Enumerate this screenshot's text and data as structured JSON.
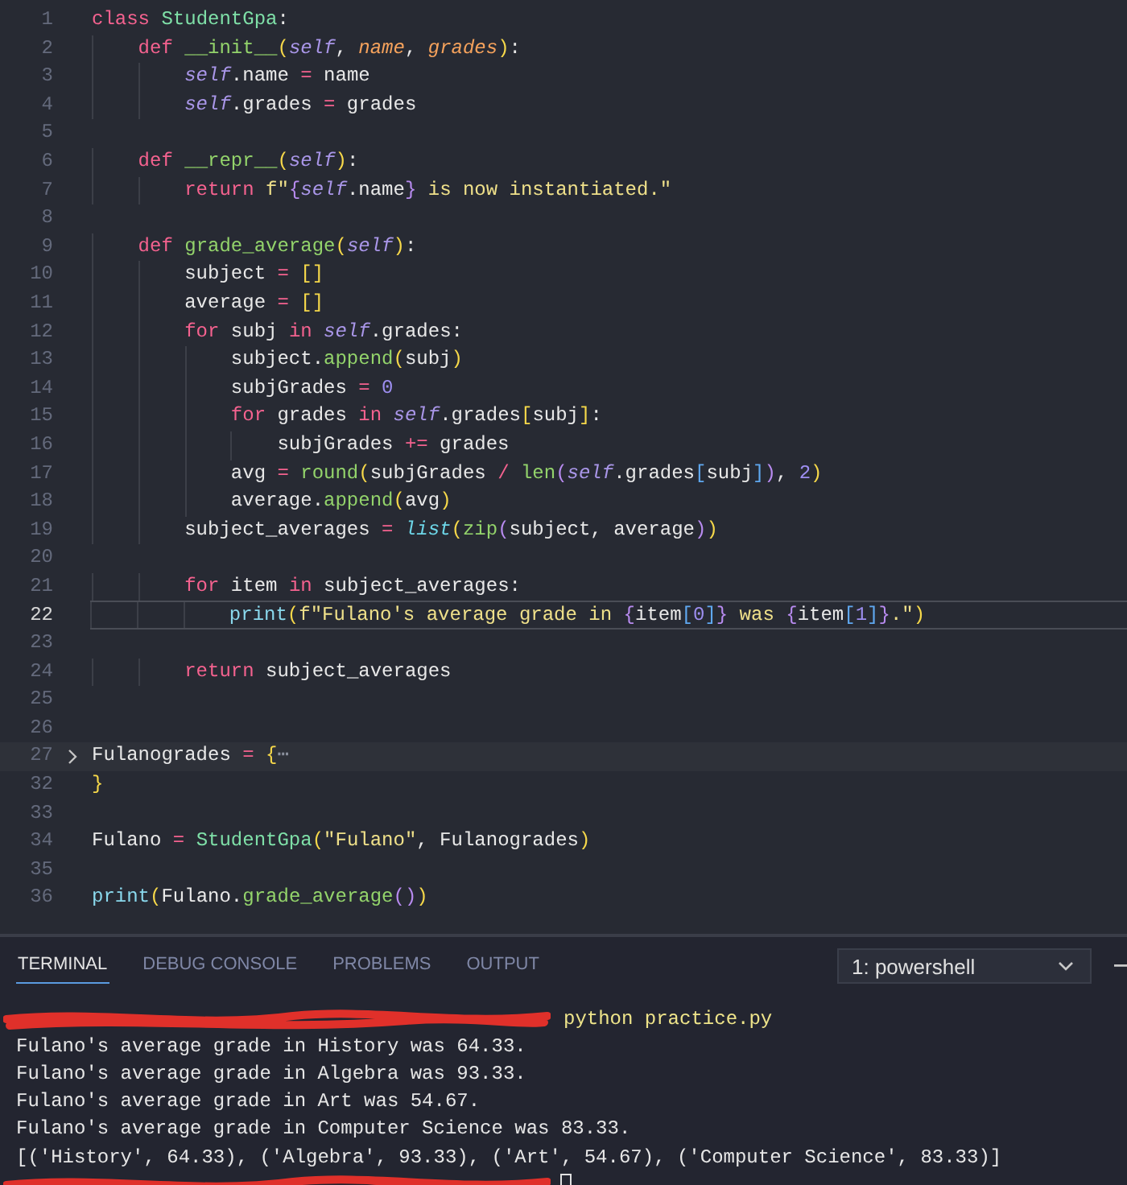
{
  "editor": {
    "lines": [
      {
        "number": "1",
        "tokens": [
          {
            "kind": "kw",
            "text": "class"
          },
          {
            "kind": "cls",
            "text": " StudentGpa"
          },
          {
            "kind": "plain",
            "text": ":"
          }
        ]
      },
      {
        "number": "2",
        "tokens": [
          {
            "kind": "kw",
            "text": "    def"
          },
          {
            "kind": "fn",
            "text": " __init__"
          },
          {
            "kind": "br",
            "text": "("
          },
          {
            "kind": "self",
            "text": "self"
          },
          {
            "kind": "plain",
            "text": ", "
          },
          {
            "kind": "param",
            "text": "name"
          },
          {
            "kind": "plain",
            "text": ", "
          },
          {
            "kind": "param",
            "text": "grades"
          },
          {
            "kind": "br",
            "text": ")"
          },
          {
            "kind": "plain",
            "text": ":"
          }
        ]
      },
      {
        "number": "3",
        "tokens": [
          {
            "kind": "self",
            "text": "        self"
          },
          {
            "kind": "plain",
            "text": ".name "
          },
          {
            "kind": "op",
            "text": "="
          },
          {
            "kind": "plain",
            "text": " name"
          }
        ]
      },
      {
        "number": "4",
        "tokens": [
          {
            "kind": "self",
            "text": "        self"
          },
          {
            "kind": "plain",
            "text": ".grades "
          },
          {
            "kind": "op",
            "text": "="
          },
          {
            "kind": "plain",
            "text": " grades"
          }
        ]
      },
      {
        "number": "5"
      },
      {
        "number": "6",
        "tokens": [
          {
            "kind": "kw",
            "text": "    def"
          },
          {
            "kind": "fn",
            "text": " __repr__"
          },
          {
            "kind": "br",
            "text": "("
          },
          {
            "kind": "self",
            "text": "self"
          },
          {
            "kind": "br",
            "text": ")"
          },
          {
            "kind": "plain",
            "text": ":"
          }
        ]
      },
      {
        "number": "7",
        "tokens": [
          {
            "kind": "kw",
            "text": "        return"
          },
          {
            "kind": "str",
            "text": " f\""
          },
          {
            "kind": "br2",
            "text": "{"
          },
          {
            "kind": "self",
            "text": "self"
          },
          {
            "kind": "plain",
            "text": ".name"
          },
          {
            "kind": "br2",
            "text": "}"
          },
          {
            "kind": "str",
            "text": " is now instantiated.\""
          }
        ]
      },
      {
        "number": "8"
      },
      {
        "number": "9",
        "tokens": [
          {
            "kind": "kw",
            "text": "    def"
          },
          {
            "kind": "fn",
            "text": " grade_average"
          },
          {
            "kind": "br",
            "text": "("
          },
          {
            "kind": "self",
            "text": "self"
          },
          {
            "kind": "br",
            "text": ")"
          },
          {
            "kind": "plain",
            "text": ":"
          }
        ]
      },
      {
        "number": "10",
        "tokens": [
          {
            "kind": "plain",
            "text": "        subject "
          },
          {
            "kind": "op",
            "text": "="
          },
          {
            "kind": "br",
            "text": " []"
          }
        ]
      },
      {
        "number": "11",
        "tokens": [
          {
            "kind": "plain",
            "text": "        average "
          },
          {
            "kind": "op",
            "text": "="
          },
          {
            "kind": "br",
            "text": " []"
          }
        ]
      },
      {
        "number": "12",
        "tokens": [
          {
            "kind": "kw",
            "text": "        for"
          },
          {
            "kind": "plain",
            "text": " subj "
          },
          {
            "kind": "kw",
            "text": "in"
          },
          {
            "kind": "self",
            "text": " self"
          },
          {
            "kind": "plain",
            "text": ".grades:"
          }
        ]
      },
      {
        "number": "13",
        "tokens": [
          {
            "kind": "plain",
            "text": "            subject."
          },
          {
            "kind": "fn",
            "text": "append"
          },
          {
            "kind": "br",
            "text": "("
          },
          {
            "kind": "plain",
            "text": "subj"
          },
          {
            "kind": "br",
            "text": ")"
          }
        ]
      },
      {
        "number": "14",
        "tokens": [
          {
            "kind": "plain",
            "text": "            subjGrades "
          },
          {
            "kind": "op",
            "text": "="
          },
          {
            "kind": "num",
            "text": " 0"
          }
        ]
      },
      {
        "number": "15",
        "tokens": [
          {
            "kind": "kw",
            "text": "            for"
          },
          {
            "kind": "plain",
            "text": " grades "
          },
          {
            "kind": "kw",
            "text": "in"
          },
          {
            "kind": "self",
            "text": " self"
          },
          {
            "kind": "plain",
            "text": ".grades"
          },
          {
            "kind": "br",
            "text": "["
          },
          {
            "kind": "plain",
            "text": "subj"
          },
          {
            "kind": "br",
            "text": "]"
          },
          {
            "kind": "plain",
            "text": ":"
          }
        ]
      },
      {
        "number": "16",
        "tokens": [
          {
            "kind": "plain",
            "text": "                subjGrades "
          },
          {
            "kind": "op",
            "text": "+="
          },
          {
            "kind": "plain",
            "text": " grades"
          }
        ]
      },
      {
        "number": "17",
        "tokens": [
          {
            "kind": "plain",
            "text": "            avg "
          },
          {
            "kind": "op",
            "text": "="
          },
          {
            "kind": "fn",
            "text": " round"
          },
          {
            "kind": "br",
            "text": "("
          },
          {
            "kind": "plain",
            "text": "subjGrades "
          },
          {
            "kind": "op",
            "text": "/"
          },
          {
            "kind": "fn",
            "text": " len"
          },
          {
            "kind": "br2",
            "text": "("
          },
          {
            "kind": "self",
            "text": "self"
          },
          {
            "kind": "plain",
            "text": ".grades"
          },
          {
            "kind": "br3",
            "text": "["
          },
          {
            "kind": "plain",
            "text": "subj"
          },
          {
            "kind": "br3",
            "text": "]"
          },
          {
            "kind": "br2",
            "text": ")"
          },
          {
            "kind": "plain",
            "text": ", "
          },
          {
            "kind": "num",
            "text": "2"
          },
          {
            "kind": "br",
            "text": ")"
          }
        ]
      },
      {
        "number": "18",
        "tokens": [
          {
            "kind": "plain",
            "text": "            average."
          },
          {
            "kind": "fn",
            "text": "append"
          },
          {
            "kind": "br",
            "text": "("
          },
          {
            "kind": "plain",
            "text": "avg"
          },
          {
            "kind": "br",
            "text": ")"
          }
        ]
      },
      {
        "number": "19",
        "tokens": [
          {
            "kind": "plain",
            "text": "        subject_averages "
          },
          {
            "kind": "op",
            "text": "="
          },
          {
            "kind": "builtin",
            "text": " list"
          },
          {
            "kind": "br",
            "text": "("
          },
          {
            "kind": "fn",
            "text": "zip"
          },
          {
            "kind": "br2",
            "text": "("
          },
          {
            "kind": "plain",
            "text": "subject, average"
          },
          {
            "kind": "br2",
            "text": ")"
          },
          {
            "kind": "br",
            "text": ")"
          }
        ]
      },
      {
        "number": "20"
      },
      {
        "number": "21",
        "tokens": [
          {
            "kind": "kw",
            "text": "        for"
          },
          {
            "kind": "plain",
            "text": " item "
          },
          {
            "kind": "kw",
            "text": "in"
          },
          {
            "kind": "plain",
            "text": " subject_averages:"
          }
        ]
      },
      {
        "number": "22",
        "current": true,
        "tokens": [
          {
            "kind": "call",
            "text": "            print"
          },
          {
            "kind": "br",
            "text": "("
          },
          {
            "kind": "str",
            "text": "f\"Fulano's average grade in "
          },
          {
            "kind": "br2",
            "text": "{"
          },
          {
            "kind": "plain",
            "text": "item"
          },
          {
            "kind": "br3",
            "text": "["
          },
          {
            "kind": "num",
            "text": "0"
          },
          {
            "kind": "br3",
            "text": "]"
          },
          {
            "kind": "br2",
            "text": "}"
          },
          {
            "kind": "str",
            "text": " was "
          },
          {
            "kind": "br2",
            "text": "{"
          },
          {
            "kind": "plain",
            "text": "item"
          },
          {
            "kind": "br3",
            "text": "["
          },
          {
            "kind": "num",
            "text": "1"
          },
          {
            "kind": "br3",
            "text": "]"
          },
          {
            "kind": "br2",
            "text": "}"
          },
          {
            "kind": "str",
            "text": ".\""
          },
          {
            "kind": "br",
            "text": ")"
          }
        ]
      },
      {
        "number": "23"
      },
      {
        "number": "24",
        "tokens": [
          {
            "kind": "kw",
            "text": "        return"
          },
          {
            "kind": "plain",
            "text": " subject_averages"
          }
        ]
      },
      {
        "number": "25"
      },
      {
        "number": "26"
      },
      {
        "number": "27",
        "folded": true,
        "tokens": [
          {
            "kind": "plain",
            "text": "Fulanogrades "
          },
          {
            "kind": "op",
            "text": "="
          },
          {
            "kind": "br",
            "text": " {"
          },
          {
            "kind": "fold",
            "text": "⋯"
          }
        ]
      },
      {
        "number": "32",
        "tokens": [
          {
            "kind": "br",
            "text": "}"
          }
        ]
      },
      {
        "number": "33"
      },
      {
        "number": "34",
        "tokens": [
          {
            "kind": "plain",
            "text": "Fulano "
          },
          {
            "kind": "op",
            "text": "="
          },
          {
            "kind": "cls",
            "text": " StudentGpa"
          },
          {
            "kind": "br",
            "text": "("
          },
          {
            "kind": "str",
            "text": "\"Fulano\""
          },
          {
            "kind": "plain",
            "text": ", Fulanogrades"
          },
          {
            "kind": "br",
            "text": ")"
          }
        ]
      },
      {
        "number": "35"
      },
      {
        "number": "36",
        "tokens": [
          {
            "kind": "call",
            "text": "print"
          },
          {
            "kind": "br",
            "text": "("
          },
          {
            "kind": "plain",
            "text": "Fulano."
          },
          {
            "kind": "fn",
            "text": "grade_average"
          },
          {
            "kind": "br2",
            "text": "()"
          },
          {
            "kind": "br",
            "text": ")"
          }
        ]
      }
    ]
  },
  "panel": {
    "tabs": [
      {
        "label": "TERMINAL",
        "selected": true
      },
      {
        "label": "DEBUG CONSOLE",
        "selected": false
      },
      {
        "label": "PROBLEMS",
        "selected": false
      },
      {
        "label": "OUTPUT",
        "selected": false
      }
    ],
    "shell_dropdown": {
      "value": "1: powershell"
    },
    "terminal_lines": [
      {
        "kind": "prompt",
        "command": "python practice.py"
      },
      {
        "kind": "output",
        "text": "Fulano's average grade in History was 64.33."
      },
      {
        "kind": "output",
        "text": "Fulano's average grade in Algebra was 93.33."
      },
      {
        "kind": "output",
        "text": "Fulano's average grade in Art was 54.67."
      },
      {
        "kind": "output",
        "text": "Fulano's average grade in Computer Science was 83.33."
      },
      {
        "kind": "output",
        "text": "[('History', 64.33), ('Algebra', 93.33), ('Art', 54.67), ('Computer Science', 83.33)]"
      },
      {
        "kind": "cursor_prompt"
      }
    ]
  }
}
